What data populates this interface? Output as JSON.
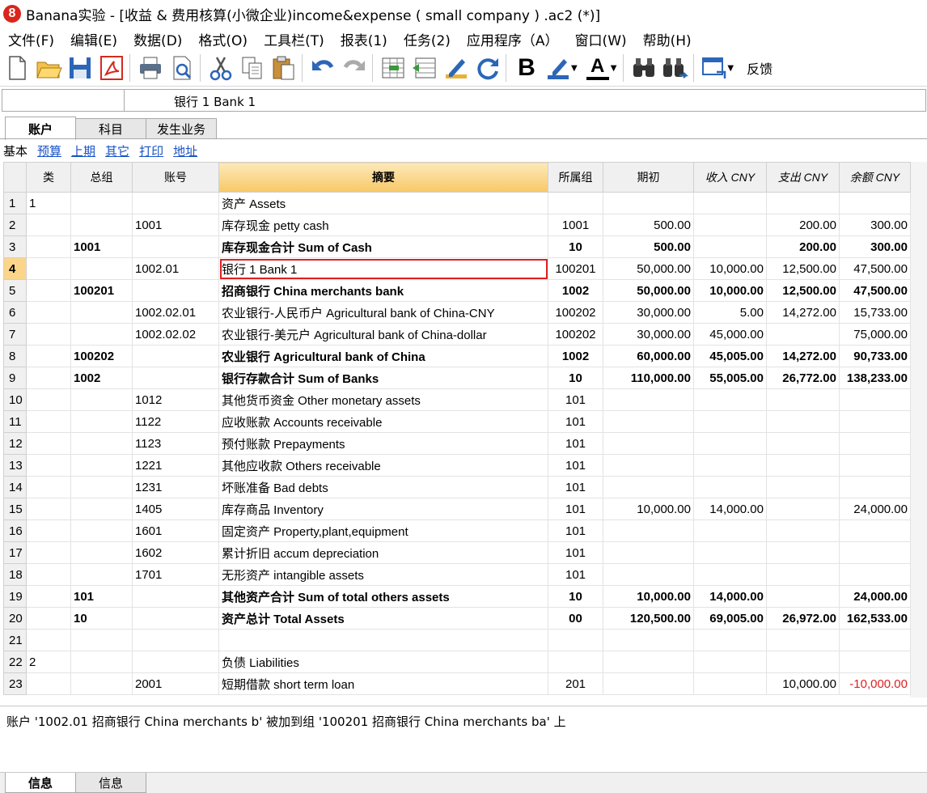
{
  "window": {
    "title": "Banana实验 - [收益 & 费用核算(小微企业)income&expense ( small company ) .ac2 (*)]",
    "icon": "banana-logo-icon"
  },
  "menu": [
    "文件(F)",
    "编辑(E)",
    "数据(D)",
    "格式(O)",
    "工具栏(T)",
    "报表(1)",
    "任务(2)",
    "应用程序（A）",
    "窗口(W)",
    "帮助(H)"
  ],
  "toolbar": {
    "feedback_label": "反馈",
    "bold_glyph": "B",
    "font_color_glyph": "A"
  },
  "cellbar": {
    "value": "银行 1  Bank 1"
  },
  "tabs": [
    "账户",
    "科目",
    "发生业务"
  ],
  "views": {
    "current": "基本",
    "links": [
      "预算",
      "上期",
      "其它",
      "打印",
      "地址"
    ]
  },
  "columns": [
    "",
    "类",
    "总组",
    "账号",
    "摘要",
    "所属组",
    "期初",
    "收入 CNY",
    "支出 CNY",
    "余额 CNY"
  ],
  "rows": [
    {
      "n": "1",
      "cls": "1",
      "gr": "",
      "acc": "",
      "desc": "资产 Assets",
      "grp": "",
      "open": "",
      "inc": "",
      "exp": "",
      "bal": "",
      "bold": false
    },
    {
      "n": "2",
      "cls": "",
      "gr": "",
      "acc": "1001",
      "desc": "库存现金 petty cash",
      "grp": "1001",
      "open": "500.00",
      "inc": "",
      "exp": "200.00",
      "bal": "300.00",
      "bold": false
    },
    {
      "n": "3",
      "cls": "",
      "gr": "1001",
      "acc": "",
      "desc": "库存现金合计 Sum of Cash",
      "grp": "10",
      "open": "500.00",
      "inc": "",
      "exp": "200.00",
      "bal": "300.00",
      "bold": true
    },
    {
      "n": "4",
      "cls": "",
      "gr": "",
      "acc": "1002.01",
      "desc": "银行 1  Bank 1",
      "grp": "100201",
      "open": "50,000.00",
      "inc": "10,000.00",
      "exp": "12,500.00",
      "bal": "47,500.00",
      "bold": false,
      "selected": true
    },
    {
      "n": "5",
      "cls": "",
      "gr": "100201",
      "acc": "",
      "desc": "招商银行 China merchants bank",
      "grp": "1002",
      "open": "50,000.00",
      "inc": "10,000.00",
      "exp": "12,500.00",
      "bal": "47,500.00",
      "bold": true
    },
    {
      "n": "6",
      "cls": "",
      "gr": "",
      "acc": "1002.02.01",
      "desc": "农业银行-人民币户 Agricultural bank of China-CNY",
      "grp": "100202",
      "open": "30,000.00",
      "inc": "5.00",
      "exp": "14,272.00",
      "bal": "15,733.00",
      "bold": false
    },
    {
      "n": "7",
      "cls": "",
      "gr": "",
      "acc": "1002.02.02",
      "desc": "农业银行-美元户 Agricultural bank of China-dollar",
      "grp": "100202",
      "open": "30,000.00",
      "inc": "45,000.00",
      "exp": "",
      "bal": "75,000.00",
      "bold": false
    },
    {
      "n": "8",
      "cls": "",
      "gr": "100202",
      "acc": "",
      "desc": "农业银行 Agricultural bank of China",
      "grp": "1002",
      "open": "60,000.00",
      "inc": "45,005.00",
      "exp": "14,272.00",
      "bal": "90,733.00",
      "bold": true
    },
    {
      "n": "9",
      "cls": "",
      "gr": "1002",
      "acc": "",
      "desc": "银行存款合计 Sum of Banks",
      "grp": "10",
      "open": "110,000.00",
      "inc": "55,005.00",
      "exp": "26,772.00",
      "bal": "138,233.00",
      "bold": true
    },
    {
      "n": "10",
      "cls": "",
      "gr": "",
      "acc": "1012",
      "desc": "其他货币资金 Other monetary assets",
      "grp": "101",
      "open": "",
      "inc": "",
      "exp": "",
      "bal": "",
      "bold": false
    },
    {
      "n": "11",
      "cls": "",
      "gr": "",
      "acc": "1122",
      "desc": "应收账款 Accounts receivable",
      "grp": "101",
      "open": "",
      "inc": "",
      "exp": "",
      "bal": "",
      "bold": false
    },
    {
      "n": "12",
      "cls": "",
      "gr": "",
      "acc": "1123",
      "desc": "预付账款 Prepayments",
      "grp": "101",
      "open": "",
      "inc": "",
      "exp": "",
      "bal": "",
      "bold": false
    },
    {
      "n": "13",
      "cls": "",
      "gr": "",
      "acc": "1221",
      "desc": "其他应收款 Others receivable",
      "grp": "101",
      "open": "",
      "inc": "",
      "exp": "",
      "bal": "",
      "bold": false
    },
    {
      "n": "14",
      "cls": "",
      "gr": "",
      "acc": "1231",
      "desc": "坏账准备 Bad debts",
      "grp": "101",
      "open": "",
      "inc": "",
      "exp": "",
      "bal": "",
      "bold": false
    },
    {
      "n": "15",
      "cls": "",
      "gr": "",
      "acc": "1405",
      "desc": "库存商品 Inventory",
      "grp": "101",
      "open": "10,000.00",
      "inc": "14,000.00",
      "exp": "",
      "bal": "24,000.00",
      "bold": false
    },
    {
      "n": "16",
      "cls": "",
      "gr": "",
      "acc": "1601",
      "desc": "固定资产 Property,plant,equipment",
      "grp": "101",
      "open": "",
      "inc": "",
      "exp": "",
      "bal": "",
      "bold": false
    },
    {
      "n": "17",
      "cls": "",
      "gr": "",
      "acc": "1602",
      "desc": "累计折旧 accum depreciation",
      "grp": "101",
      "open": "",
      "inc": "",
      "exp": "",
      "bal": "",
      "bold": false
    },
    {
      "n": "18",
      "cls": "",
      "gr": "",
      "acc": "1701",
      "desc": "无形资产 intangible assets",
      "grp": "101",
      "open": "",
      "inc": "",
      "exp": "",
      "bal": "",
      "bold": false
    },
    {
      "n": "19",
      "cls": "",
      "gr": "101",
      "acc": "",
      "desc": "其他资产合计 Sum of total others assets",
      "grp": "10",
      "open": "10,000.00",
      "inc": "14,000.00",
      "exp": "",
      "bal": "24,000.00",
      "bold": true
    },
    {
      "n": "20",
      "cls": "",
      "gr": "10",
      "acc": "",
      "desc": "资产总计  Total Assets",
      "grp": "00",
      "open": "120,500.00",
      "inc": "69,005.00",
      "exp": "26,972.00",
      "bal": "162,533.00",
      "bold": true
    },
    {
      "n": "21",
      "cls": "",
      "gr": "",
      "acc": "",
      "desc": "",
      "grp": "",
      "open": "",
      "inc": "",
      "exp": "",
      "bal": "",
      "bold": false
    },
    {
      "n": "22",
      "cls": "2",
      "gr": "",
      "acc": "",
      "desc": "负债  Liabilities",
      "grp": "",
      "open": "",
      "inc": "",
      "exp": "",
      "bal": "",
      "bold": false
    },
    {
      "n": "23",
      "cls": "",
      "gr": "",
      "acc": "2001",
      "desc": "短期借款  short term loan",
      "grp": "201",
      "open": "",
      "inc": "",
      "exp": "10,000.00",
      "bal": "-10,000.00",
      "bold": false,
      "negative": true
    }
  ],
  "message": "账户 '1002.01 招商银行 China merchants b' 被加到组 '100201 招商银行 China merchants ba' 上",
  "bottom_tabs": [
    "信息",
    "信息"
  ],
  "colors": {
    "selected_header": "#f7c867",
    "focus_outline": "#e02020",
    "negative": "#e02020",
    "link": "#1a53c6"
  }
}
